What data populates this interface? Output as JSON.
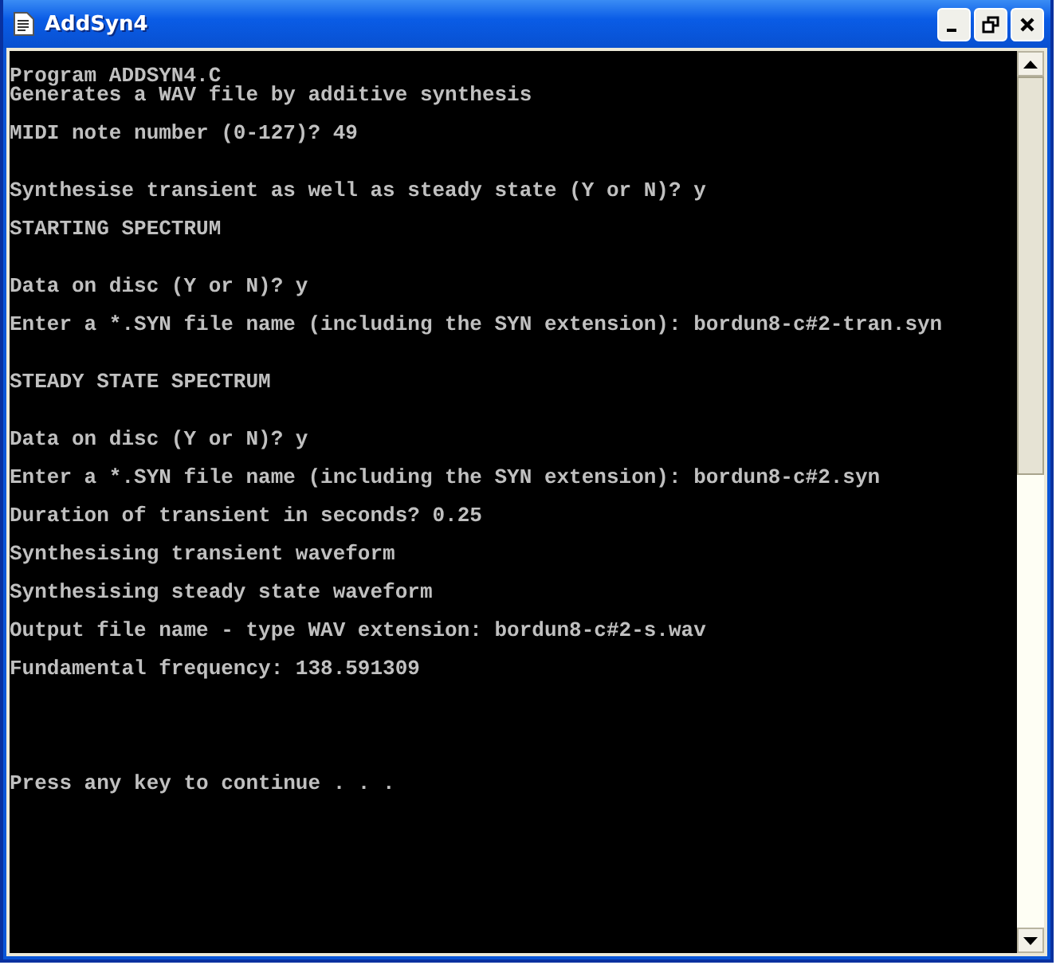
{
  "window": {
    "title": "AddSyn4"
  },
  "console": {
    "lines": [
      {
        "kind": "text",
        "text": "Program ADDSYN4.C"
      },
      {
        "kind": "text",
        "text": "Generates a WAV file by additive synthesis"
      },
      {
        "kind": "blank"
      },
      {
        "kind": "text",
        "text": "MIDI note number (0-127)? 49"
      },
      {
        "kind": "blank"
      },
      {
        "kind": "blank"
      },
      {
        "kind": "text",
        "text": "Synthesise transient as well as steady state (Y or N)? y"
      },
      {
        "kind": "blank"
      },
      {
        "kind": "text",
        "text": "STARTING SPECTRUM"
      },
      {
        "kind": "blank"
      },
      {
        "kind": "blank"
      },
      {
        "kind": "text",
        "text": "Data on disc (Y or N)? y"
      },
      {
        "kind": "blank"
      },
      {
        "kind": "text",
        "text": "Enter a *.SYN file name (including the SYN extension): bordun8-c#2-tran.syn"
      },
      {
        "kind": "blank"
      },
      {
        "kind": "blank"
      },
      {
        "kind": "text",
        "text": "STEADY STATE SPECTRUM"
      },
      {
        "kind": "blank"
      },
      {
        "kind": "blank"
      },
      {
        "kind": "text",
        "text": "Data on disc (Y or N)? y"
      },
      {
        "kind": "blank"
      },
      {
        "kind": "text",
        "text": "Enter a *.SYN file name (including the SYN extension): bordun8-c#2.syn"
      },
      {
        "kind": "blank"
      },
      {
        "kind": "text",
        "text": "Duration of transient in seconds? 0.25"
      },
      {
        "kind": "blank"
      },
      {
        "kind": "text",
        "text": "Synthesising transient waveform"
      },
      {
        "kind": "blank"
      },
      {
        "kind": "text",
        "text": "Synthesising steady state waveform"
      },
      {
        "kind": "blank"
      },
      {
        "kind": "text",
        "text": "Output file name - type WAV extension: bordun8-c#2-s.wav"
      },
      {
        "kind": "blank"
      },
      {
        "kind": "text",
        "text": "Fundamental frequency: 138.591309"
      },
      {
        "kind": "blank"
      },
      {
        "kind": "blank"
      },
      {
        "kind": "blank"
      },
      {
        "kind": "blank"
      },
      {
        "kind": "blank"
      },
      {
        "kind": "text",
        "text": "Press any key to continue . . ."
      }
    ]
  }
}
